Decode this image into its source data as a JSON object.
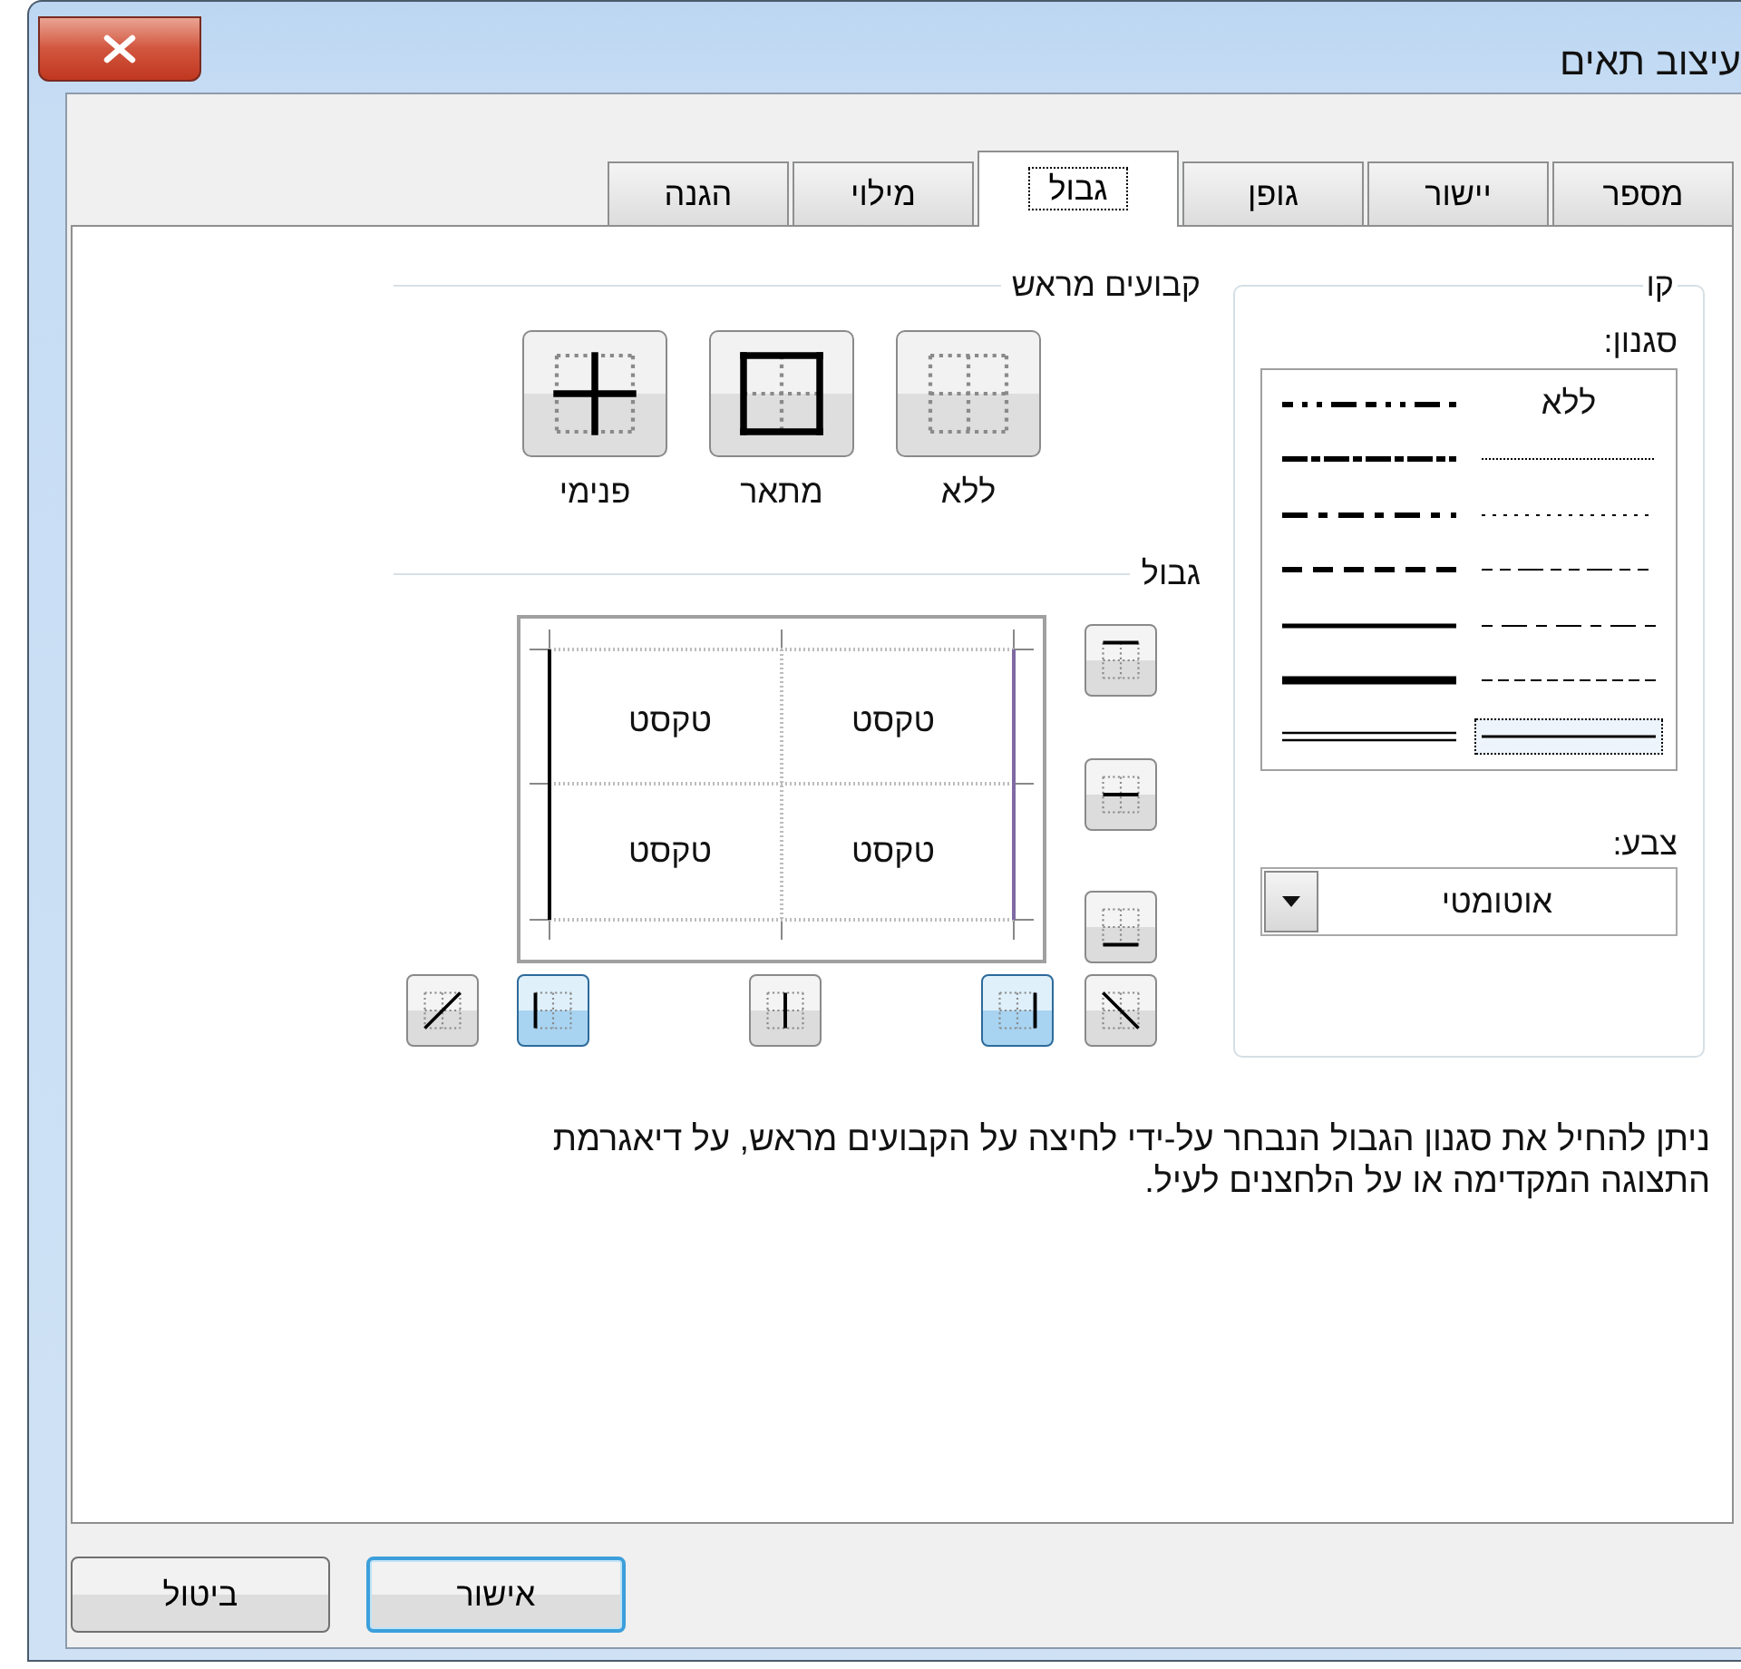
{
  "window": {
    "title": "עיצוב תאים"
  },
  "tabs": [
    {
      "label": "מספר",
      "selected": false
    },
    {
      "label": "יישור",
      "selected": false
    },
    {
      "label": "גופן",
      "selected": false
    },
    {
      "label": "גבול",
      "selected": true
    },
    {
      "label": "מילוי",
      "selected": false
    },
    {
      "label": "הגנה",
      "selected": false
    }
  ],
  "line": {
    "legend": "קו",
    "style_label": "סגנון:",
    "color_label": "צבע:",
    "color_value": "אוטומטי",
    "styles": [
      {
        "kind": "none",
        "label": "ללא",
        "selected": false
      },
      {
        "kind": "hair",
        "selected": false
      },
      {
        "kind": "dotted",
        "selected": false
      },
      {
        "kind": "dash-dot-dot",
        "selected": false
      },
      {
        "kind": "dash-dot",
        "selected": false
      },
      {
        "kind": "dashed",
        "selected": false
      },
      {
        "kind": "thin",
        "selected": true
      },
      {
        "kind": "medium-dash-dot-dot",
        "selected": false
      },
      {
        "kind": "slant-dash-dot",
        "selected": false
      },
      {
        "kind": "medium-dash-dot",
        "selected": false
      },
      {
        "kind": "medium-dashed",
        "selected": false
      },
      {
        "kind": "medium",
        "selected": false
      },
      {
        "kind": "thick",
        "selected": false
      },
      {
        "kind": "double",
        "selected": false
      }
    ]
  },
  "presets": {
    "title": "קבועים מראש",
    "items": [
      {
        "kind": "none",
        "label": "ללא"
      },
      {
        "kind": "outline",
        "label": "מתאר"
      },
      {
        "kind": "inside",
        "label": "פנימי"
      }
    ]
  },
  "border": {
    "title": "גבול",
    "buttons": [
      {
        "kind": "top",
        "selected": false
      },
      {
        "kind": "middle-h",
        "selected": false
      },
      {
        "kind": "bottom",
        "selected": false
      },
      {
        "kind": "diag-down",
        "selected": false
      },
      {
        "kind": "right",
        "selected": true,
        "color": "#7f6aa3"
      },
      {
        "kind": "middle-v",
        "selected": false
      },
      {
        "kind": "left",
        "selected": true,
        "color": "#000000"
      },
      {
        "kind": "diag-up",
        "selected": false
      }
    ],
    "preview_cells": [
      "טקסט",
      "טקסט",
      "טקסט",
      "טקסט"
    ]
  },
  "hint": "ניתן להחיל את סגנון הגבול הנבחר על-ידי לחיצה על הקבועים מראש, על דיאגרמת התצוגה המקדימה או על הלחצנים לעיל.",
  "buttons": [
    {
      "label": "אישור",
      "default": true
    },
    {
      "label": "ביטול",
      "default": false
    }
  ]
}
